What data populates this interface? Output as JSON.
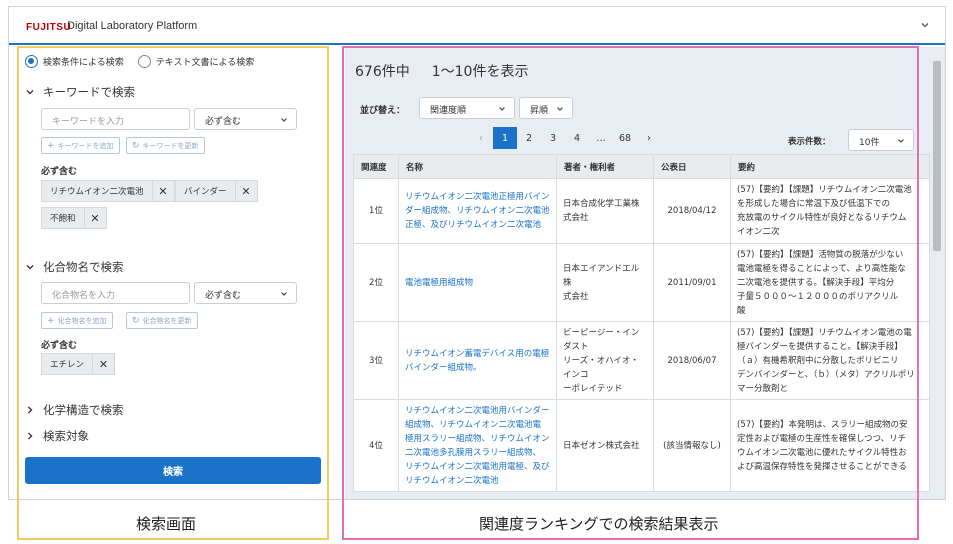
{
  "header": {
    "logo": "FUJITSU",
    "title": "Digital Laboratory Platform",
    "menu_icon": "chevron-down-icon"
  },
  "search_mode": {
    "option_condition": "検索条件による検索",
    "option_text": "テキスト文書による検索",
    "selected": "option_condition"
  },
  "keyword_section": {
    "title": "キーワードで検索",
    "input_placeholder": "キーワードを入力",
    "match_select": "必ず含む",
    "add_button": "キーワードを追加",
    "update_button": "キーワードを更新",
    "must_label": "必ず含む",
    "chips": [
      "リチウムイオン二次電池",
      "バインダー",
      "不飽和"
    ]
  },
  "compound_section": {
    "title": "化合物名で検索",
    "input_placeholder": "化合物名を入力",
    "match_select": "必ず含む",
    "add_button": "化合物名を追加",
    "update_button": "化合物名を更新",
    "must_label": "必ず含む",
    "chips": [
      "エチレン"
    ]
  },
  "structure_section": {
    "title": "化学構造で検索"
  },
  "target_section": {
    "title": "検索対象"
  },
  "search_button": "検索",
  "results": {
    "total": "676件中",
    "range": "1〜10件を表示",
    "sort_label": "並び替え：",
    "sort_by": "関連度順",
    "sort_order": "昇順",
    "pages": [
      "1",
      "2",
      "3",
      "4",
      "…",
      "68"
    ],
    "current_page": "1",
    "per_page_label": "表示件数：",
    "per_page": "10件",
    "columns": [
      "関連度",
      "名称",
      "著者・権利者",
      "公表日",
      "要約"
    ],
    "rows": [
      {
        "rank": "1位",
        "title": [
          "リチウムイオン二次電池正極用バイン",
          "ダー組成物、リチウムイオン二次電池",
          "正極、及びリチウムイオン二次電池"
        ],
        "owner": [
          "日本合成化学工業株",
          "式会社"
        ],
        "date": "2018/04/12",
        "summary": [
          "(57)【要約】【課題】リチウムイオン二次電池",
          "を形成した場合に常温下及び低温下での",
          "充放電のサイクル特性が良好となるリチウム",
          "イオン二次"
        ]
      },
      {
        "rank": "2位",
        "title": [
          "電池電極用組成物"
        ],
        "owner": [
          "日本エイアンドエル株",
          "式会社"
        ],
        "date": "2011/09/01",
        "summary": [
          "(57)【要約】【課題】活物質の脱落が少ない",
          "電池電極を得ることによって、より高性能な",
          "二次電池を提供する。【解決手段】平均分",
          "子量５０００〜１２０００のポリアクリル",
          "酸"
        ]
      },
      {
        "rank": "3位",
        "title": [
          "リチウムイオン蓄電デバイス用の電極",
          "バインダー組成物。"
        ],
        "owner": [
          "ビーピージー・インダスト",
          "リーズ・オハイオ・インコ",
          "ーポレイテッド"
        ],
        "date": "2018/06/07",
        "summary": [
          "(57)【要約】【課題】リチウムイオン電池の電",
          "極バインダーを提供すること。【解決手段】",
          "（ａ）有機希釈剤中に分散したポリビニリ",
          "デンバインダーと、（ｂ）（メタ）アクリルポリ",
          "マー分散剤と"
        ]
      },
      {
        "rank": "4位",
        "title": [
          "リチウムイオン二次電池用バインダー",
          "組成物、リチウムイオン二次電池電",
          "極用スラリー組成物、リチウムイオン",
          "二次電池多孔膜用スラリー組成物、",
          "リチウムイオン二次電池用電極、及び",
          "リチウムイオン二次電池"
        ],
        "owner": [
          "日本ゼオン株式会社"
        ],
        "date": "(該当情報なし)",
        "summary": [
          "(57)【要約】本発明は、スラリー組成物の安",
          "定性および電極の生産性を確保しつつ、リチ",
          "ウムイオン二次電池に優れたサイクル特性お",
          "よび高温保存特性を発揮させることができる"
        ]
      }
    ]
  },
  "captions": {
    "left": "検索画面",
    "right": "関連度ランキングでの検索結果表示"
  }
}
